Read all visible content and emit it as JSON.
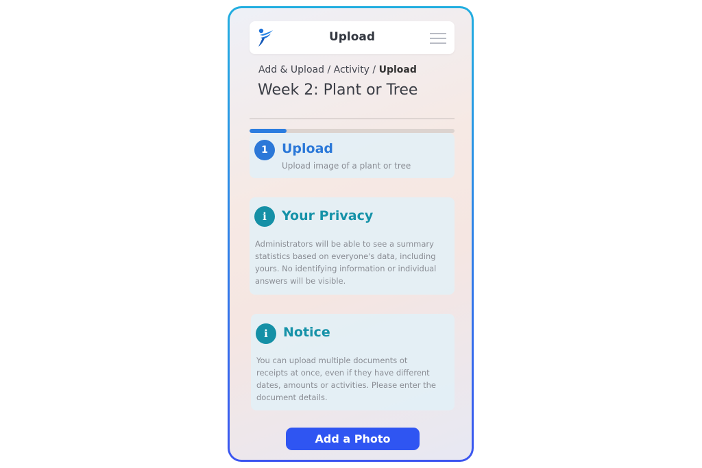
{
  "header": {
    "title": "Upload",
    "logo_icon": "brand-figure-icon",
    "menu_icon": "hamburger-menu-icon"
  },
  "breadcrumb": {
    "items": [
      "Add & Upload",
      "Activity"
    ],
    "separator": "/",
    "current": "Upload"
  },
  "page": {
    "title": "Week 2: Plant or Tree"
  },
  "progress": {
    "value": 0.18,
    "color": "#2b7de0"
  },
  "step": {
    "number": "1",
    "title": "Upload",
    "description": "Upload image of a plant or tree"
  },
  "privacy": {
    "icon": "i",
    "title": "Your Privacy",
    "lines": [
      "Administrators will be able to see a summary",
      "statistics based on everyone's data, including",
      "yours. No identifying information or individual",
      "answers will be visible."
    ]
  },
  "notice": {
    "icon": "i",
    "title": "Notice",
    "lines": [
      "You can upload multiple documents ot",
      "receipts at once, even if they have different",
      "dates, amounts or activities. Please enter the",
      "document details."
    ]
  },
  "actions": {
    "add_photo_label": "Add a Photo"
  },
  "colors": {
    "accent_blue": "#2b78d8",
    "accent_teal": "#1592a8",
    "button": "#2f55f2",
    "frame_top": "#22aee0",
    "frame_bottom": "#3b55f0"
  }
}
